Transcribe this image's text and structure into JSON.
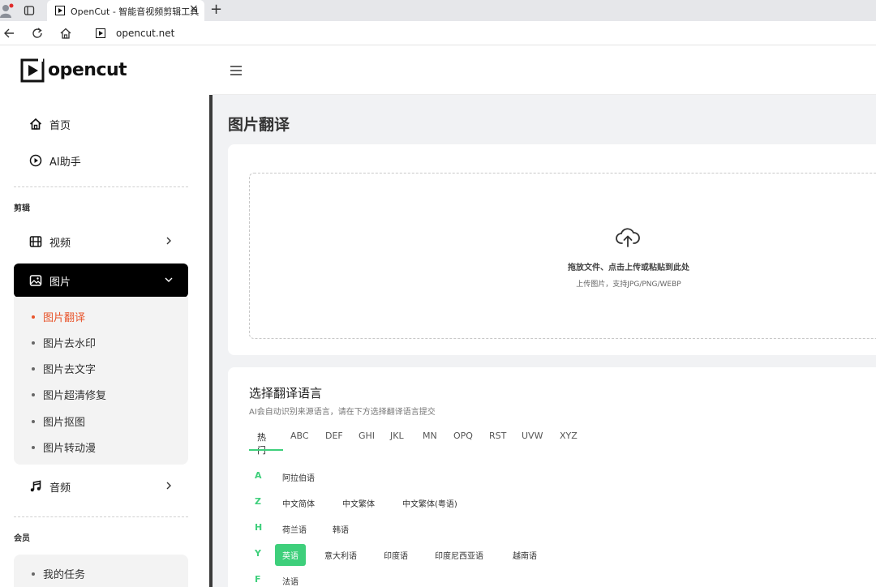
{
  "browser": {
    "tab_title": "OpenCut - 智能音视频剪辑工具",
    "close_glyph": "×",
    "new_tab_glyph": "+",
    "url": "opencut.net"
  },
  "sidebar": {
    "logo_text": "opencut",
    "top_items": [
      {
        "label": "首页",
        "icon": "home-icon"
      },
      {
        "label": "AI助手",
        "icon": "play-circle-icon"
      }
    ],
    "section_edit": "剪辑",
    "video_label": "视频",
    "image_label": "图片",
    "image_subitems": [
      "图片翻译",
      "图片去水印",
      "图片去文字",
      "图片超清修复",
      "图片抠图",
      "图片转动漫"
    ],
    "active_subitem": "图片翻译",
    "audio_label": "音频",
    "section_member": "会员",
    "member_items": [
      "我的任务"
    ]
  },
  "main": {
    "page_title": "图片翻译",
    "upload": {
      "main_text": "拖放文件、点击上传或粘贴到此处",
      "sub_text": "上传图片，支持JPG/PNG/WEBP"
    },
    "language": {
      "title": "选择翻译语言",
      "description": "AI会自动识别来源语言，请在下方选择翻译语言提交",
      "tabs": [
        "热门",
        "ABC",
        "DEF",
        "GHI",
        "JKL",
        "MN",
        "OPQ",
        "RST",
        "UVW",
        "XYZ"
      ],
      "active_tab": "热门",
      "rows": [
        {
          "letter": "A",
          "languages": [
            "阿拉伯语"
          ]
        },
        {
          "letter": "Z",
          "languages": [
            "中文简体",
            "中文繁体",
            "中文繁体(粤语)"
          ]
        },
        {
          "letter": "H",
          "languages": [
            "荷兰语",
            "韩语"
          ]
        },
        {
          "letter": "Y",
          "languages": [
            "英语",
            "意大利语",
            "印度语",
            "印度尼西亚语",
            "越南语"
          ]
        },
        {
          "letter": "F",
          "languages": [
            "法语"
          ]
        }
      ],
      "selected_language": "英语"
    }
  },
  "colors": {
    "accent_green": "#3ecf7b",
    "active_orange": "#e8542b",
    "sidebar_active_bg": "#000000"
  }
}
